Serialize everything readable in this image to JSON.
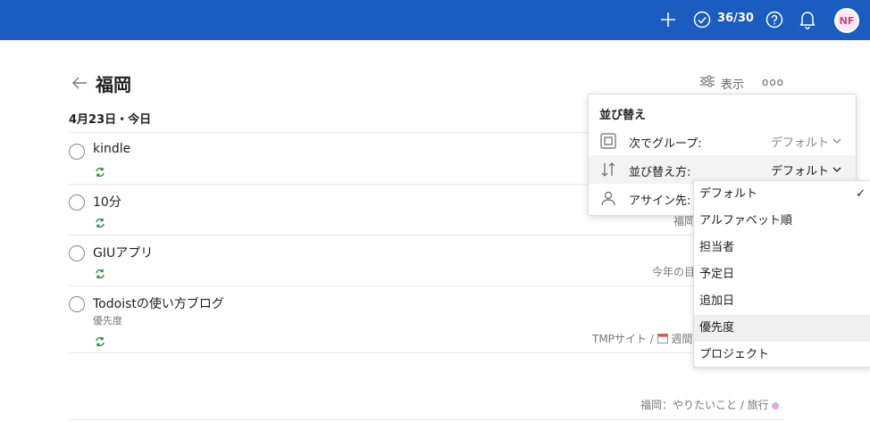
{
  "topbar": {
    "karma_count": "36/30",
    "avatar_initials": "NF",
    "bg_color": "#1a5cbf"
  },
  "page": {
    "title": "福岡",
    "view_label": "表示",
    "more_label": "ooo"
  },
  "section": {
    "heading": "4月23日・今日"
  },
  "tasks": [
    {
      "title": "kindle",
      "meta": ""
    },
    {
      "title": "10分",
      "meta": "福岡"
    },
    {
      "title": "GIUアプリ",
      "meta": "今年の目"
    },
    {
      "title": "Todoistの使い方ブログ",
      "description": "優先度",
      "meta_project": "TMPサイト / ",
      "meta_section": "週間"
    }
  ],
  "footer": {
    "project_path": "福岡：やりたいこと / 旅行"
  },
  "sort_popover": {
    "title": "並び替え",
    "rows": [
      {
        "label": "次でグループ:",
        "value": "デフォルト"
      },
      {
        "label": "並び替え方:",
        "value": "デフォルト"
      },
      {
        "label": "アサイン先:",
        "value": ""
      }
    ]
  },
  "sort_dropdown": {
    "options": [
      "デフォルト",
      "アルファベット順",
      "担当者",
      "予定日",
      "追加日",
      "優先度",
      "プロジェクト"
    ],
    "selected": "デフォルト",
    "check": "✓"
  }
}
